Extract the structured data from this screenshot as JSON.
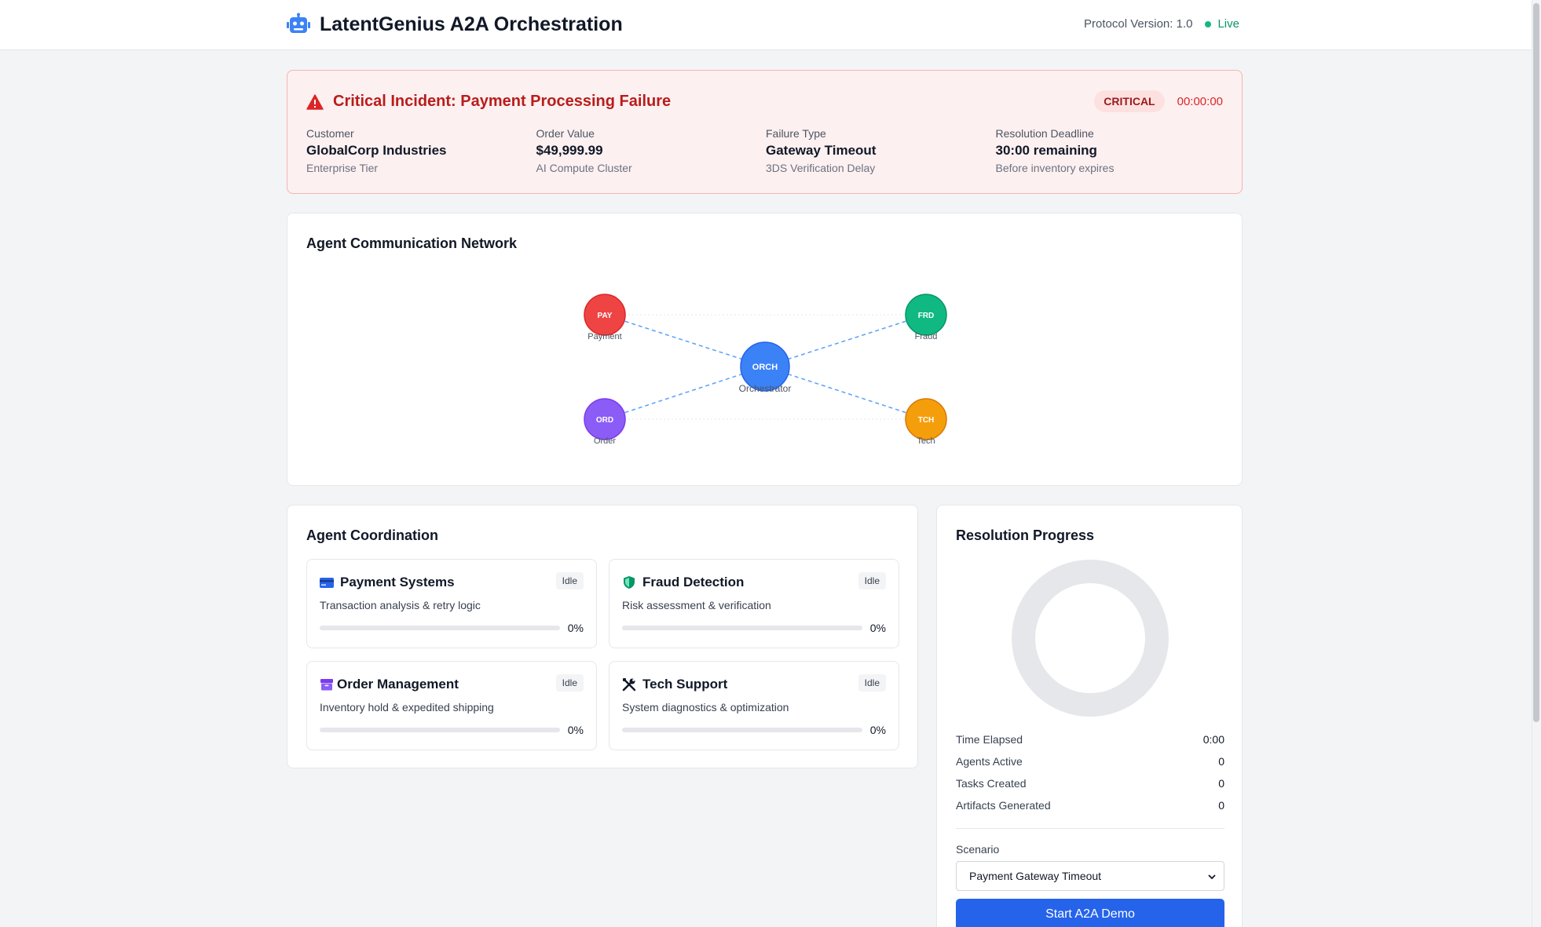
{
  "header": {
    "title": "LatentGenius A2A Orchestration",
    "protocol": "Protocol Version: 1.0",
    "status": "Live"
  },
  "incident": {
    "title": "Critical Incident: Payment Processing Failure",
    "severity": "CRITICAL",
    "timer": "00:00:00",
    "fields": [
      {
        "label": "Customer",
        "value": "GlobalCorp Industries",
        "sub": "Enterprise Tier"
      },
      {
        "label": "Order Value",
        "value": "$49,999.99",
        "sub": "AI Compute Cluster"
      },
      {
        "label": "Failure Type",
        "value": "Gateway Timeout",
        "sub": "3DS Verification Delay"
      },
      {
        "label": "Resolution Deadline",
        "value": "30:00 remaining",
        "sub": "Before inventory expires"
      }
    ]
  },
  "network": {
    "title": "Agent Communication Network",
    "nodes": [
      {
        "code": "ORCH",
        "label": "Orchestrator",
        "color": "#3b82f6"
      },
      {
        "code": "PAY",
        "label": "Payment",
        "color": "#ef4444"
      },
      {
        "code": "FRD",
        "label": "Fraud",
        "color": "#10b981"
      },
      {
        "code": "ORD",
        "label": "Order",
        "color": "#8b5cf6"
      },
      {
        "code": "TCH",
        "label": "Tech",
        "color": "#f59e0b"
      }
    ]
  },
  "coordination": {
    "title": "Agent Coordination",
    "agents": [
      {
        "name": "Payment Systems",
        "status": "Idle",
        "desc": "Transaction analysis & retry logic",
        "progress": "0%",
        "icon": "credit-card-icon",
        "color": "#2563eb"
      },
      {
        "name": "Fraud Detection",
        "status": "Idle",
        "desc": "Risk assessment & verification",
        "progress": "0%",
        "icon": "shield-icon",
        "color": "#059669"
      },
      {
        "name": "Order Management",
        "status": "Idle",
        "desc": "Inventory hold & expedited shipping",
        "progress": "0%",
        "icon": "box-icon",
        "color": "#7c3aed"
      },
      {
        "name": "Tech Support",
        "status": "Idle",
        "desc": "System diagnostics & optimization",
        "progress": "0%",
        "icon": "tools-icon",
        "color": "#111827"
      }
    ]
  },
  "progress": {
    "title": "Resolution Progress",
    "stats": [
      {
        "label": "Time Elapsed",
        "value": "0:00"
      },
      {
        "label": "Agents Active",
        "value": "0"
      },
      {
        "label": "Tasks Created",
        "value": "0"
      },
      {
        "label": "Artifacts Generated",
        "value": "0"
      }
    ],
    "scenario_label": "Scenario",
    "scenario_value": "Payment Gateway Timeout",
    "start_label": "Start A2A Demo"
  }
}
